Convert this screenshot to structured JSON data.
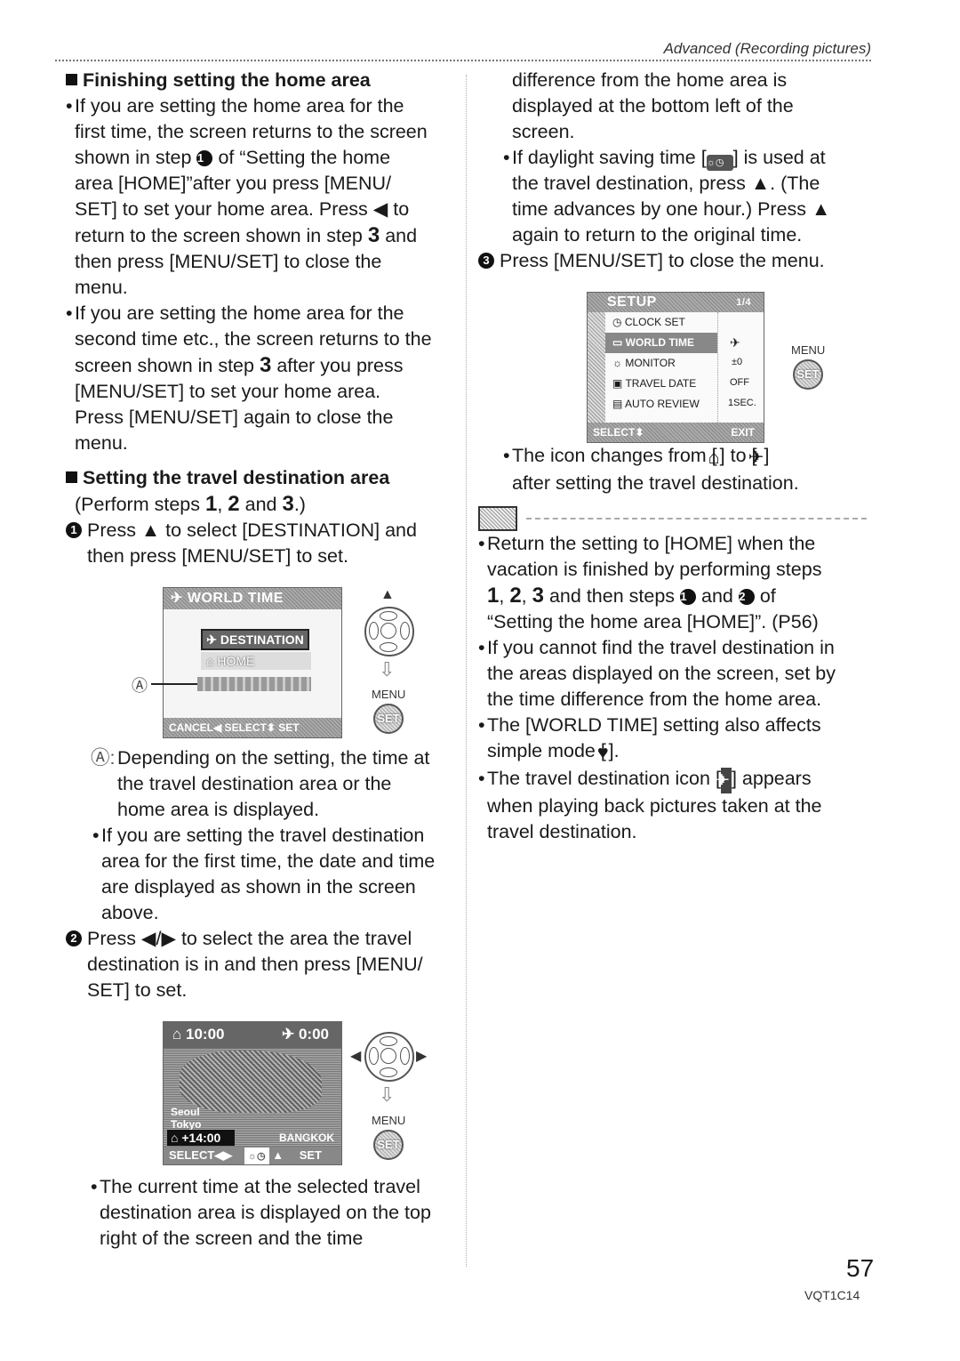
{
  "header": {
    "section_title": "Advanced (Recording pictures)"
  },
  "left": {
    "finishing": {
      "heading": "Finishing setting the home area",
      "bullet1": [
        "If you are setting the home area for the",
        "first time, the screen returns to the screen",
        "shown in step",
        "of “Setting the home",
        "area [HOME]”after you press [MENU/",
        "SET] to set your home area. Press ◀ to",
        "return to the screen shown in step",
        "and",
        "then press [MENU/SET] to close the",
        "menu."
      ],
      "bullet2": [
        "If you are setting the home area for the",
        "second time etc., the screen returns to the",
        "screen shown in step",
        "after you press",
        "[MENU/SET] to set your home area.",
        "Press [MENU/SET] again to close the",
        "menu."
      ]
    },
    "travel": {
      "heading": "Setting the travel destination area",
      "perform": [
        "(Perform steps",
        "1",
        ", ",
        "2",
        " and ",
        "3",
        ".)"
      ],
      "step1": [
        "Press ▲ to select [DESTINATION] and",
        "then press [MENU/SET] to set."
      ],
      "note_a_label": "Ⓐ:",
      "note_a": [
        "Depending on the setting, the time at",
        "the travel destination area or the",
        "home area is displayed."
      ],
      "bullet_first": [
        "If you are setting the travel destination",
        "area for the first time, the date and time",
        "are displayed as shown in the screen",
        "above."
      ],
      "step2": [
        "Press ◀/▶ to select the area the travel",
        "destination is in and then press [MENU/",
        "SET] to set."
      ],
      "bullet_current": [
        "The current time at the selected travel",
        "destination area is displayed on the top",
        "right of the screen and the time"
      ]
    },
    "screen1": {
      "title": "WORLD TIME",
      "option_destination": "DESTINATION",
      "option_home": "HOME",
      "footer": "CANCEL◀  SELECT⬍  SET",
      "callout": "Ⓐ"
    },
    "screen2": {
      "home_time": "10:00",
      "dest_time": "0:00",
      "cities": [
        "Seoul",
        "Tokyo"
      ],
      "offset": "+14:00",
      "region": "BANGKOK",
      "footer_select": "SELECT◀▶",
      "footer_set": "SET"
    },
    "button_labels": {
      "menu": "MENU",
      "set": "SET"
    }
  },
  "right": {
    "continued": [
      "difference from the home area is",
      "displayed at the bottom left of the",
      "screen."
    ],
    "daylight": [
      "If daylight saving time [",
      "] is used at",
      "the travel destination, press ▲. (The",
      "time advances by one hour.) Press ▲",
      "again to return to the original time."
    ],
    "step3": "Press [MENU/SET] to close the menu.",
    "setup_screen": {
      "title": "SETUP",
      "page": "1/4",
      "items": [
        {
          "label": "CLOCK SET",
          "value": ""
        },
        {
          "label": "WORLD TIME",
          "value": "✈"
        },
        {
          "label": "MONITOR",
          "value": "±0"
        },
        {
          "label": "TRAVEL DATE",
          "value": "OFF"
        },
        {
          "label": "AUTO REVIEW",
          "value": "1SEC."
        }
      ],
      "footer_select": "SELECT⬍",
      "footer_exit": "EXIT"
    },
    "icon_change": [
      "The icon changes from [",
      "] to [",
      "]",
      "after setting the travel destination."
    ],
    "notes": {
      "return": [
        "Return the setting to [HOME] when the",
        "vacation is finished by performing steps",
        "1",
        "2",
        "3",
        "and then steps",
        "and",
        "of",
        "“Setting the home area [HOME]”. (P56)"
      ],
      "cannot_find": [
        "If you cannot find the travel destination in",
        "the areas displayed on the screen, set by",
        "the time difference from the home area."
      ],
      "world_time": [
        "The [WORLD TIME] setting also affects",
        "simple mode [",
        "]."
      ],
      "travel_icon": [
        "The travel destination icon [",
        "] appears",
        "when playing back pictures taken at the",
        "travel destination."
      ]
    }
  },
  "footer": {
    "page_number": "57",
    "doc_code": "VQT1C14"
  },
  "step_numbers": {
    "one": "1",
    "two": "2",
    "three": "3"
  }
}
